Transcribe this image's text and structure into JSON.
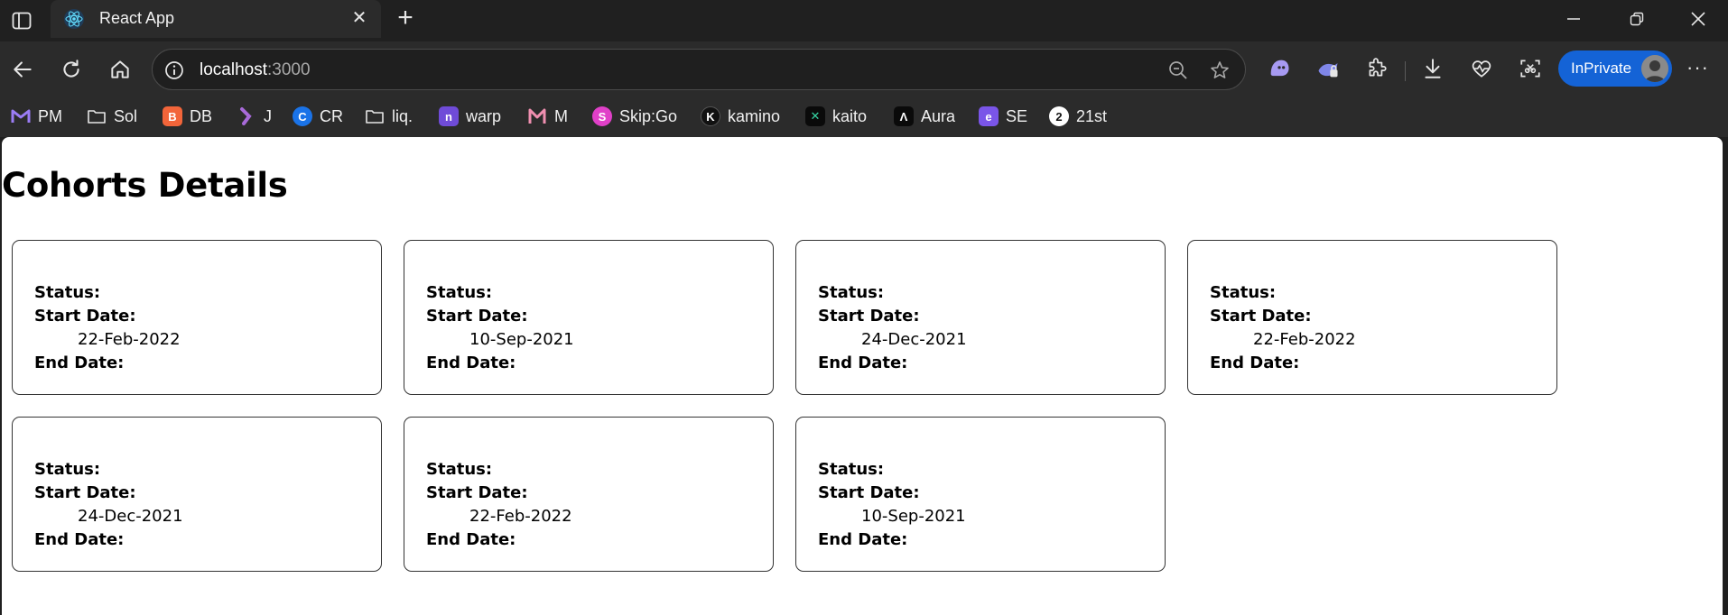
{
  "browser": {
    "tab": {
      "title": "React App"
    },
    "address": {
      "host": "localhost",
      "port": ":3000"
    },
    "inprivate_label": "InPrivate",
    "bookmarks": [
      {
        "label": "PM",
        "icon": "m-icon",
        "color": "#7b5cf0"
      },
      {
        "label": "Sol",
        "icon": "folder-icon",
        "color": ""
      },
      {
        "label": "DB",
        "icon": "db-icon",
        "color": "#f2653a"
      },
      {
        "label": "J",
        "icon": "j-icon",
        "color": "#a86ad9"
      },
      {
        "label": "CR",
        "icon": "cr-icon",
        "color": "#1a73e8"
      },
      {
        "label": "liq.",
        "icon": "folder-icon",
        "color": ""
      },
      {
        "label": "warp",
        "icon": "warp-icon",
        "color": "#6f4bd8"
      },
      {
        "label": "M",
        "icon": "m-logo-icon",
        "color": "#f08fb0"
      },
      {
        "label": "Skip:Go",
        "icon": "skip-icon",
        "color": "#e040c8"
      },
      {
        "label": "kamino",
        "icon": "kamino-icon",
        "color": "#111111"
      },
      {
        "label": "kaito",
        "icon": "kaito-icon",
        "color": "#0a0a0a"
      },
      {
        "label": "Aura",
        "icon": "aura-icon",
        "color": "#0a0a0a"
      },
      {
        "label": "SE",
        "icon": "se-icon",
        "color": "#7a55e8"
      },
      {
        "label": "21st",
        "icon": "21st-icon",
        "color": "#111111"
      }
    ]
  },
  "page": {
    "title": "Cohorts Details",
    "labels": {
      "status": "Status:",
      "start": "Start Date:",
      "end": "End Date:"
    },
    "cohorts": [
      {
        "start_date": "22-Feb-2022"
      },
      {
        "start_date": "10-Sep-2021"
      },
      {
        "start_date": "24-Dec-2021"
      },
      {
        "start_date": "22-Feb-2022"
      },
      {
        "start_date": "24-Dec-2021"
      },
      {
        "start_date": "22-Feb-2022"
      },
      {
        "start_date": "10-Sep-2021"
      }
    ]
  }
}
